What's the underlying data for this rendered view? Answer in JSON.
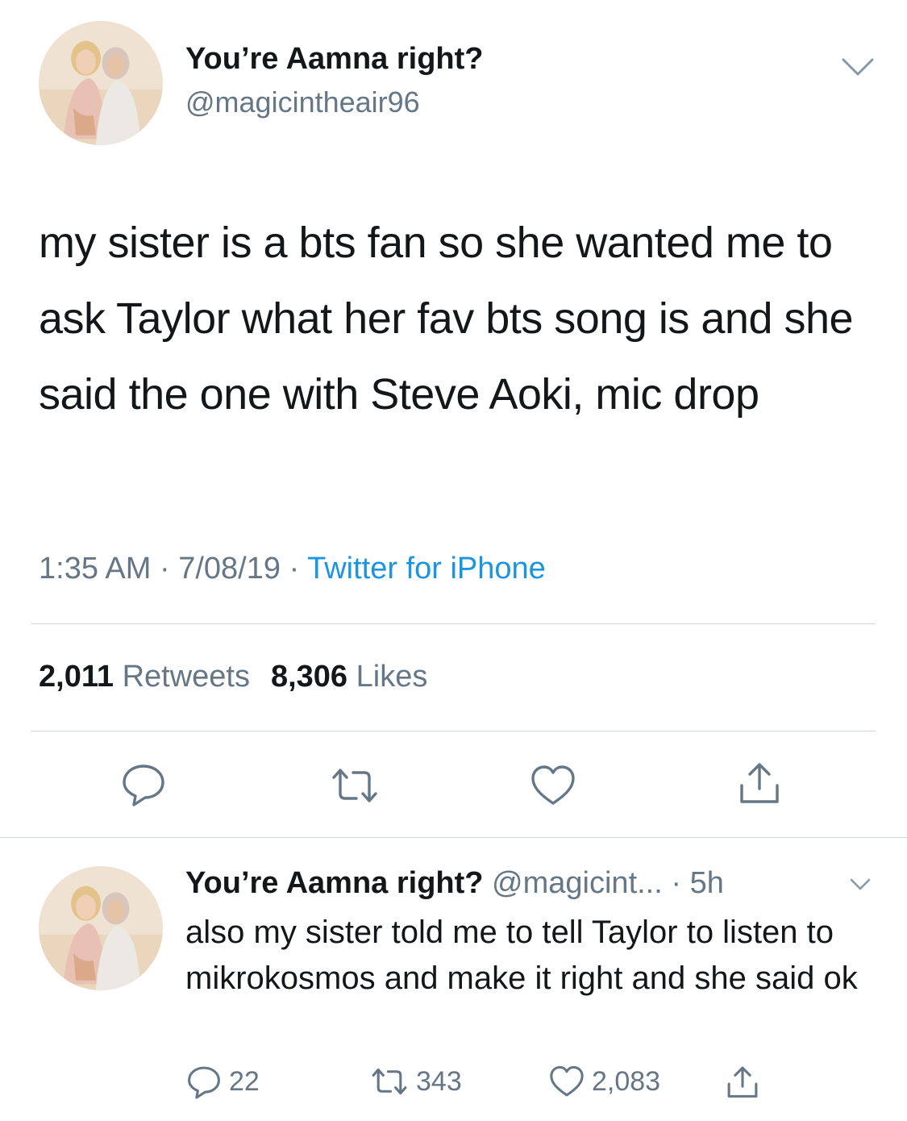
{
  "main_tweet": {
    "display_name": "You’re Aamna right?",
    "handle": "@magicintheair96",
    "text": "my sister is a bts fan so she wanted me to ask Taylor what her fav bts song is and she said the one with Steve Aoki, mic drop",
    "time": "1:35 AM",
    "date": "7/08/19",
    "separator": "·",
    "source": "Twitter for iPhone",
    "retweets_count": "2,011",
    "retweets_label": "Retweets",
    "likes_count": "8,306",
    "likes_label": "Likes"
  },
  "reply": {
    "display_name": "You’re Aamna right?",
    "handle": "@magicint...",
    "age": "· 5h",
    "text": "also my sister told me to tell Taylor to listen to mikrokosmos and make it right and she said ok",
    "reply_count": "22",
    "retweet_count": "343",
    "like_count": "2,083"
  },
  "icons": {
    "reply": "reply-bubble-icon",
    "retweet": "retweet-icon",
    "like": "heart-icon",
    "share": "share-icon",
    "menu": "chevron-down-icon"
  },
  "colors": {
    "text": "#14171a",
    "secondary": "#657786",
    "link": "#1b95e0",
    "divider": "#ccd6dd"
  }
}
